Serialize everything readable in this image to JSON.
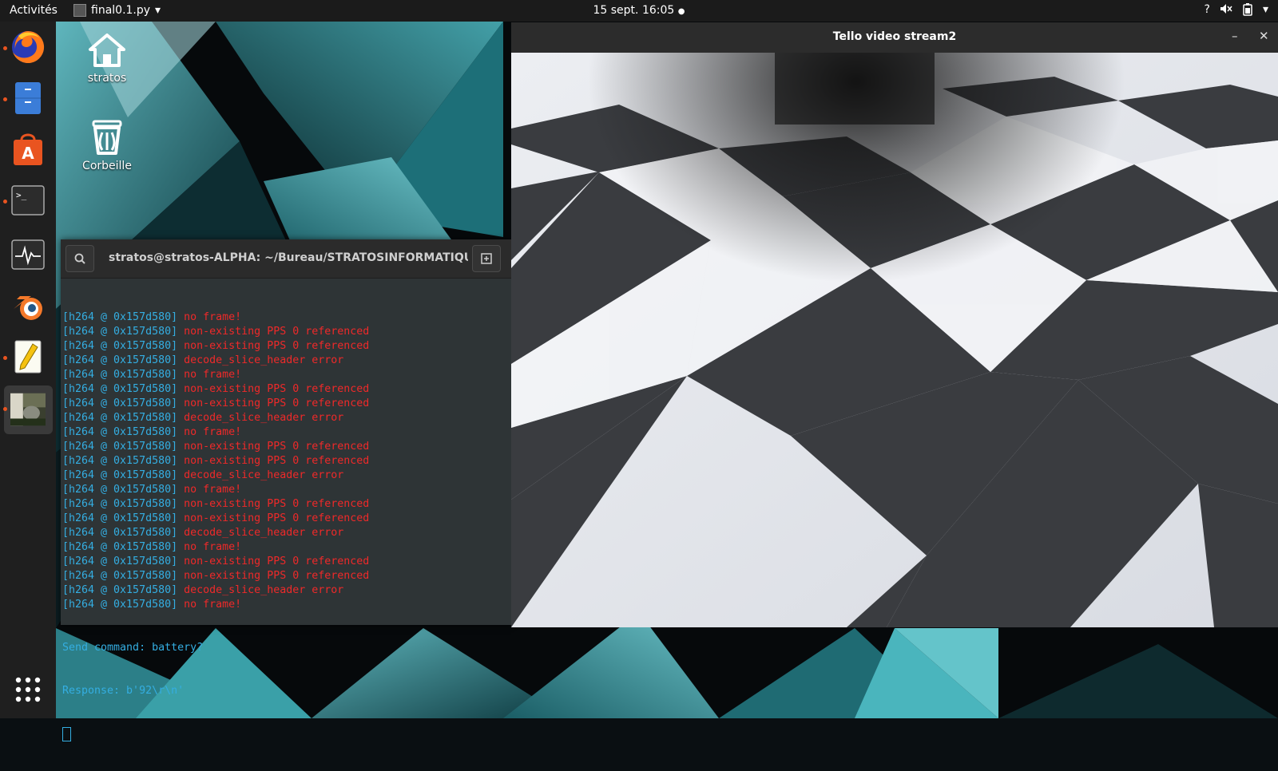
{
  "topbar": {
    "activities": "Activités",
    "app_name": "final0.1.py",
    "app_menu_arrow": "▾",
    "clock": "15 sept.  16:05",
    "clock_indicator": "●",
    "tray_icons": [
      "help-icon",
      "volume-muted-icon",
      "battery-icon",
      "system-menu-arrow-icon"
    ]
  },
  "dock": {
    "items": [
      {
        "name": "firefox",
        "icon": "firefox-icon",
        "running": true
      },
      {
        "name": "files",
        "icon": "files-icon",
        "running": true
      },
      {
        "name": "software",
        "icon": "ubuntu-software-icon",
        "running": false
      },
      {
        "name": "terminal",
        "icon": "terminal-icon",
        "running": true,
        "glyph": ">_"
      },
      {
        "name": "system-monitor",
        "icon": "system-monitor-icon",
        "running": false
      },
      {
        "name": "blender",
        "icon": "blender-icon",
        "running": false
      },
      {
        "name": "text-editor",
        "icon": "text-editor-icon",
        "running": true
      },
      {
        "name": "video-stream",
        "icon": "video-stream-thumbnail-icon",
        "running": true,
        "active": true
      }
    ],
    "show_apps_icon": "app-grid-icon"
  },
  "desktop": {
    "icons": [
      {
        "label": "stratos",
        "icon": "home-folder-icon"
      },
      {
        "label": "Corbeille",
        "icon": "trash-icon"
      }
    ]
  },
  "terminal": {
    "title": "stratos@stratos-ALPHA: ~/Bureau/STRATOSINFORMATIQU...",
    "log_prefix": "[h264 @ 0x157d580]",
    "log_lines": [
      "no frame!",
      "non-existing PPS 0 referenced",
      "non-existing PPS 0 referenced",
      "decode_slice_header error",
      "no frame!",
      "non-existing PPS 0 referenced",
      "non-existing PPS 0 referenced",
      "decode_slice_header error",
      "no frame!",
      "non-existing PPS 0 referenced",
      "non-existing PPS 0 referenced",
      "decode_slice_header error",
      "no frame!",
      "non-existing PPS 0 referenced",
      "non-existing PPS 0 referenced",
      "decode_slice_header error",
      "no frame!",
      "non-existing PPS 0 referenced",
      "non-existing PPS 0 referenced",
      "decode_slice_header error",
      "no frame!"
    ],
    "command_line": "Send command: battery?",
    "response_line": "Response: b'92\\r\\n'"
  },
  "video_window": {
    "title": "Tello video stream2",
    "minimize": "–",
    "close": "✕"
  },
  "colors": {
    "accent": "#e95420",
    "terminal_bg": "#2e3436",
    "terminal_blue": "#34aee2",
    "terminal_red": "#ef2929",
    "wallpaper_teal": "#2a8d97"
  }
}
